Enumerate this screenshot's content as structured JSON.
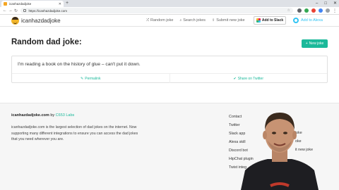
{
  "browser": {
    "tab_title": "icanhazdadjoke",
    "url": "https://icanhazdadjoke.com"
  },
  "header": {
    "brand": "icanhazdadjoke",
    "nav": [
      {
        "icon": "shuffle-icon",
        "label": "Random joke"
      },
      {
        "icon": "search-icon",
        "label": "Search jokes"
      },
      {
        "icon": "upload-icon",
        "label": "Submit new joke"
      }
    ],
    "slack_button": "Add to Slack",
    "alexa_link": "Add to Alexa"
  },
  "main": {
    "title": "Random dad joke:",
    "new_joke_button": "New joke",
    "joke": "I'm reading a book on the history of glue – can't put it down.",
    "permalink": "Permalink",
    "share_twitter": "Share on Twitter"
  },
  "footer": {
    "site": "icanhazdadjoke.com",
    "by": "by",
    "company": "C653 Labs",
    "description": "icanhazdadjoke.com is the largest selection of dad jokes on the internet. Now supporting many different integrations to ensure you can access the dad jokes that you need wherever you are.",
    "links": [
      "Contact",
      "Twitter",
      "Slack app",
      "Alexa skill",
      "Discord bot",
      "HipChat plugin",
      "Twist integ"
    ],
    "links_right": [
      "joke",
      "oke",
      "it new joke"
    ]
  },
  "colors": {
    "accent": "#1bb99a",
    "alexa": "#31c4f3"
  }
}
